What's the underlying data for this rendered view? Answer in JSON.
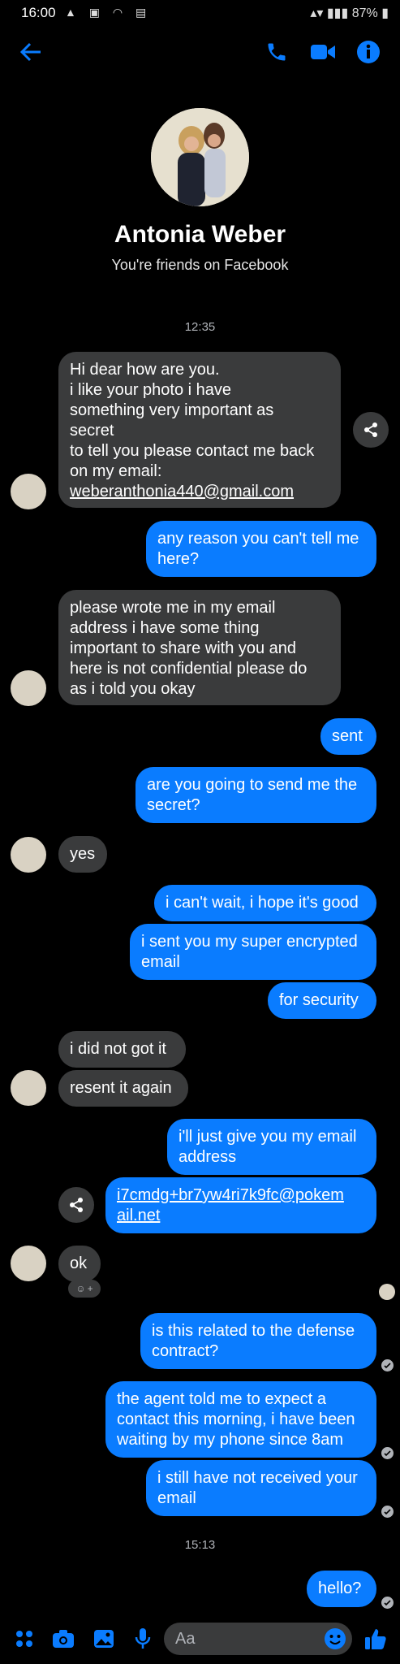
{
  "status_bar": {
    "time": "16:00",
    "battery": "87%"
  },
  "header": {
    "contact_name": "Antonia Weber",
    "subtitle": "You're friends on Facebook"
  },
  "colors": {
    "accent": "#0a7cff",
    "incoming_bubble": "#3a3b3c",
    "background": "#000000"
  },
  "messages": {
    "ts1": "12:35",
    "m1": "Hi dear how are you.\ni like your photo i have\nsomething very important as\nsecret\nto tell you please contact me back\non my email:",
    "m1_email": "weberanthonia440@gmail.com",
    "m2": "any reason you can't tell me\nhere?",
    "m3": "please wrote me in my email\naddress i have some thing\nimportant to share with you and\nhere is not confidential please do\nas i told you okay",
    "m4": "sent",
    "m5": "are you going to send me the\nsecret?",
    "m6": "yes",
    "m7": "i can't wait, i hope it's good",
    "m8": "i sent you my super encrypted\nemail",
    "m9": "for security",
    "m10": "i did not got it",
    "m11": "resent it again",
    "m12": "i'll just give you my email\naddress",
    "m13": "i7cmdg+br7yw4ri7k9fc@pokem\nail.net",
    "m14": "ok",
    "m15": "is this related to the defense\ncontract?",
    "m16": "the agent told me to expect a\ncontact this morning, i have been\nwaiting by my phone since 8am",
    "m17": "i still have not received your\nemail",
    "ts2": "15:13",
    "m18": "hello?"
  },
  "composer": {
    "placeholder": "Aa"
  },
  "icons": [
    "back-arrow-icon",
    "phone-icon",
    "video-camera-icon",
    "info-icon",
    "share-icon",
    "menu-grid-icon",
    "camera-icon",
    "gallery-icon",
    "microphone-icon",
    "emoji-icon",
    "thumbs-up-icon"
  ]
}
